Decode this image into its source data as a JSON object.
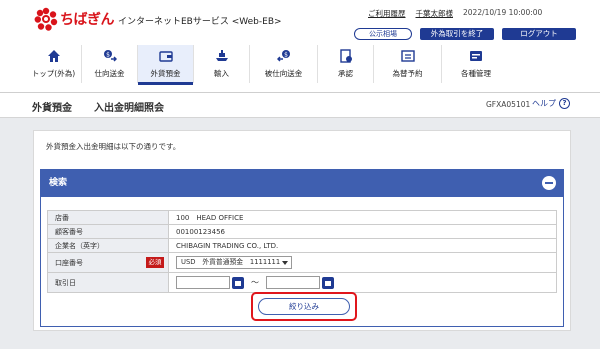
{
  "header": {
    "brand_name": "ちばぎん",
    "service_name": "インターネットEBサービス <Web-EB>",
    "help_link": "ご利用履歴",
    "user_name": "千葉太郎様",
    "datetime": "2022/10/19 10:00:00",
    "btn_public_rate": "公示相場",
    "btn_end_fx": "外為取引を終了",
    "btn_logout": "ログアウト"
  },
  "nav": [
    {
      "label": "トップ(外為)",
      "icon": "home-icon"
    },
    {
      "label": "仕向送金",
      "icon": "outward-remittance-icon"
    },
    {
      "label": "外貨預金",
      "icon": "wallet-icon",
      "active": true
    },
    {
      "label": "輸入",
      "icon": "ship-icon"
    },
    {
      "label": "被仕向送金",
      "icon": "inward-remittance-icon"
    },
    {
      "label": "承認",
      "icon": "approval-icon"
    },
    {
      "label": "為替予約",
      "icon": "exchange-icon"
    },
    {
      "label": "各種管理",
      "icon": "management-icon"
    }
  ],
  "title": {
    "section": "外貨預金",
    "page": "入出金明細照会",
    "screen_id": "GFXA05101",
    "help": "ヘルプ"
  },
  "intro": "外貨預金入出金明細は以下の通りです。",
  "search": {
    "heading": "検索",
    "fields": {
      "branch_label": "店番",
      "branch_value": "100　HEAD OFFICE",
      "customer_no_label": "顧客番号",
      "customer_no_value": "00100123456",
      "company_label": "企業名（英字）",
      "company_value": "CHIBAGIN TRADING CO., LTD.",
      "account_label": "口座番号",
      "required": "必須",
      "account_value": "USD　外貨普通預金　1111111",
      "date_label": "取引日",
      "tilde": "～"
    },
    "filter_button": "絞り込み"
  },
  "colors": {
    "brand": "#d9141b",
    "navy": "#1f3a93",
    "panel": "#3f5fb0",
    "highlight": "#e0161c"
  }
}
